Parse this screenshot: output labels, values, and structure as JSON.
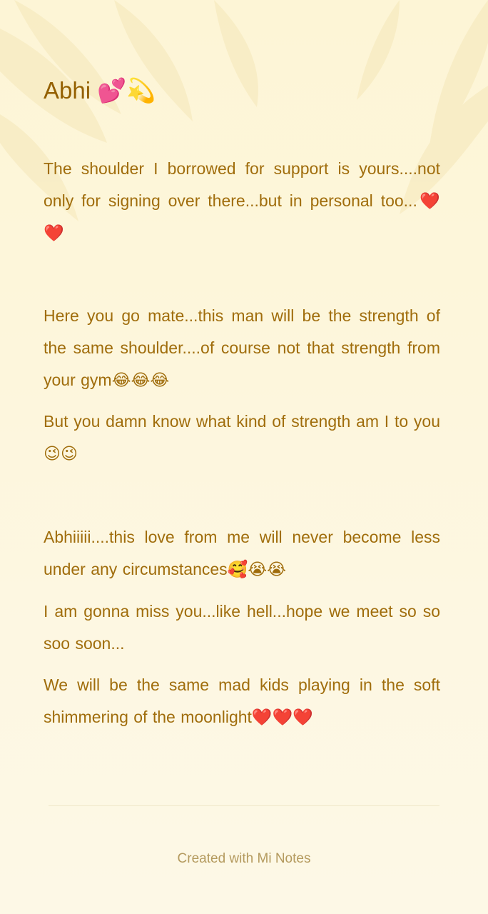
{
  "note": {
    "title": "Abhi 💕💫",
    "paragraphs": [
      "The shoulder I borrowed for support is yours....not only for signing over there...but in personal too...❤️❤️",
      "Here you go mate...this man will be the strength of the same shoulder....of course not that strength from your gym😂😂😂",
      "But you damn know what kind of strength am I to you😉😉",
      "Abhiiiii....this love from me will never become less under any circumstances🥰😭😭",
      "I am gonna miss you...like hell...hope we meet so so soo soon...",
      "We will be the same mad kids playing in the soft shimmering of the moonlight❤️❤️❤️"
    ]
  },
  "footer": {
    "text": "Created with Mi Notes"
  },
  "colors": {
    "title": "#946000",
    "body": "#a06d0c",
    "footer": "#b49a5e",
    "background": "#fdf6db"
  }
}
